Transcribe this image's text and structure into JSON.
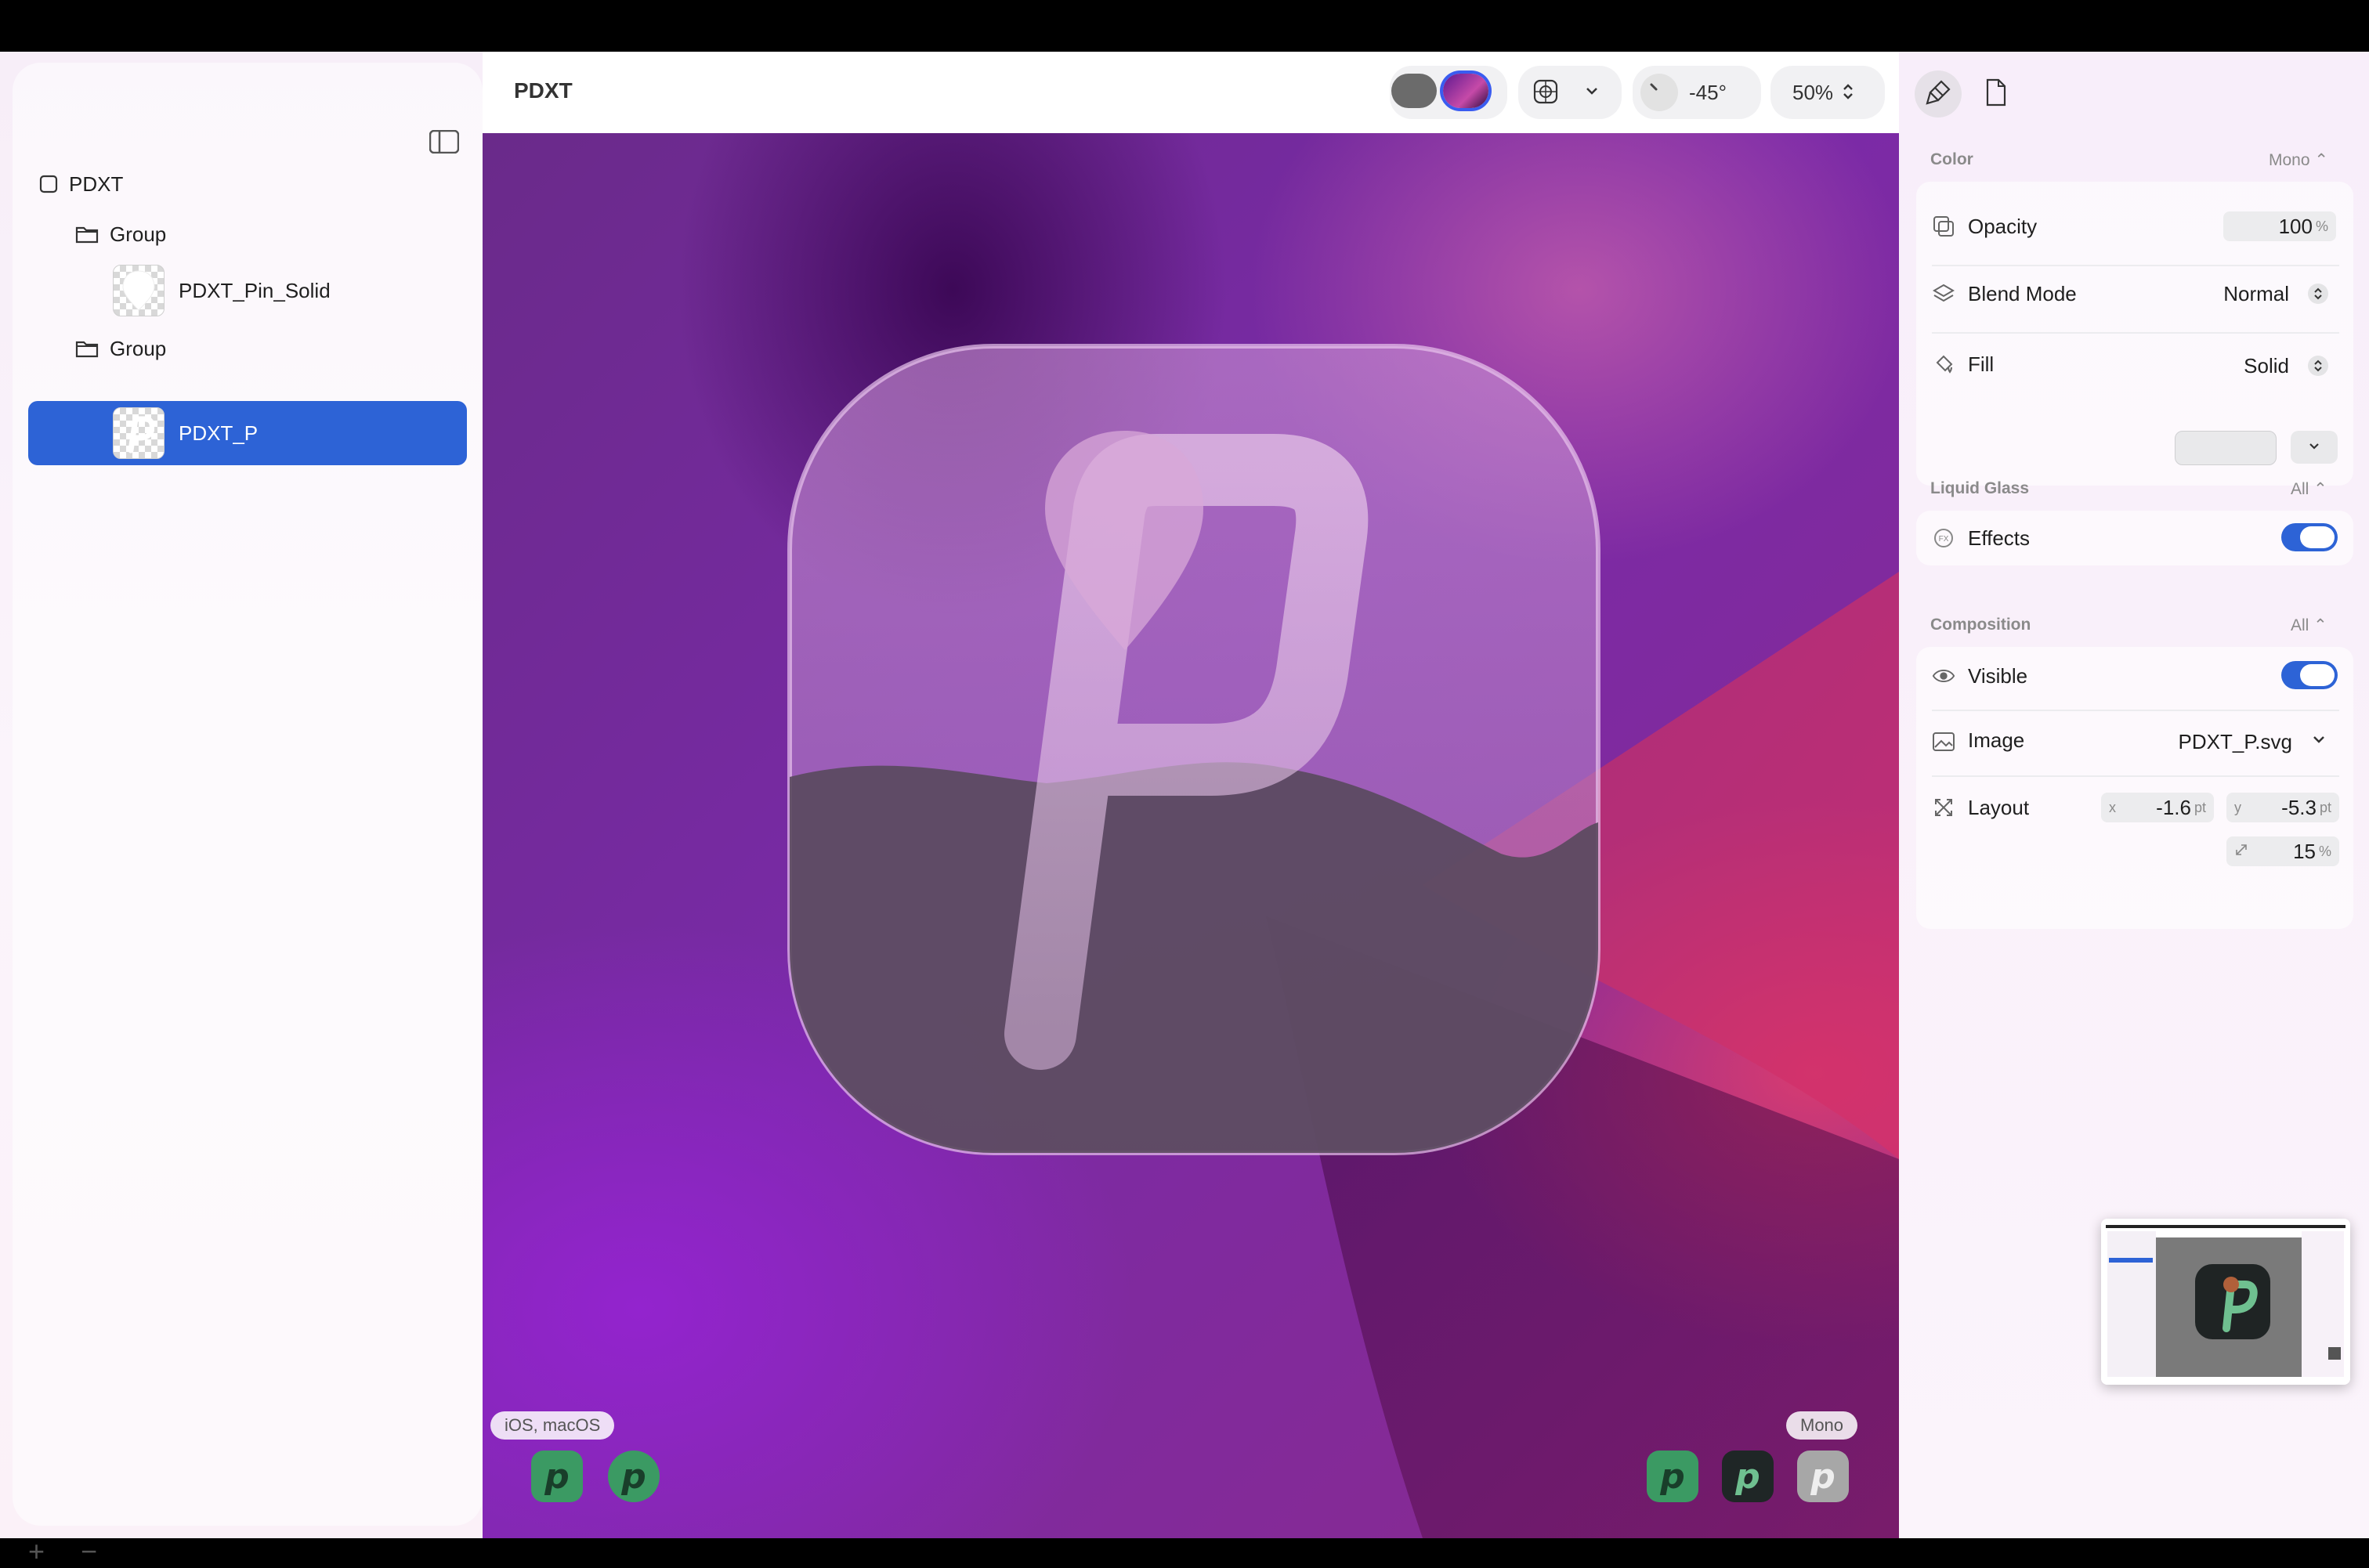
{
  "document": {
    "title": "PDXT"
  },
  "layers": {
    "root": "PDXT",
    "group1": "Group",
    "pin": "PDXT_Pin_Solid",
    "group2": "Group",
    "p": "PDXT_P"
  },
  "sidebar_footer": {
    "add": "+",
    "remove": "−"
  },
  "toolbar": {
    "angle": "-45°",
    "zoom": "50%"
  },
  "canvas": {
    "platform_chip": "iOS, macOS",
    "mode_chip": "Mono",
    "icon_letter": "p"
  },
  "inspector": {
    "color": {
      "label": "Color",
      "mode": "Mono ⌃",
      "opacity_label": "Opacity",
      "opacity_value": "100",
      "opacity_unit": "%",
      "blend_label": "Blend Mode",
      "blend_value": "Normal",
      "fill_label": "Fill",
      "fill_value": "Solid"
    },
    "liquid_glass": {
      "label": "Liquid Glass",
      "mode": "All ⌃",
      "effects_label": "Effects",
      "effects_on": true
    },
    "composition": {
      "label": "Composition",
      "mode": "All ⌃",
      "visible_label": "Visible",
      "visible_on": true,
      "image_label": "Image",
      "image_value": "PDXT_P.svg",
      "layout_label": "Layout",
      "x_letter": "x",
      "x_value": "-1.6",
      "y_letter": "y",
      "y_value": "-5.3",
      "pt_unit": "pt",
      "scale_value": "15",
      "scale_unit": "%"
    }
  },
  "colors": {
    "accent": "#2d63d6",
    "mini_green": "#2f8f5a",
    "mini_dark": "#1f2a2a",
    "mini_gray": "#a8a8a8"
  }
}
